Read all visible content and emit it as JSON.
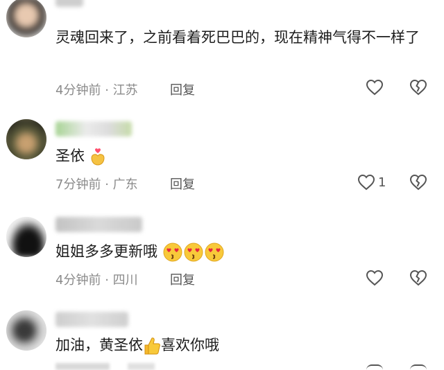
{
  "comments": [
    {
      "text": "灵魂回来了，之前看着死巴巴的，现在精神气得不一样了",
      "time": "4分钟前",
      "location": "江苏",
      "reply_label": "回复",
      "like_count": ""
    },
    {
      "text": "圣依",
      "time": "7分钟前",
      "location": "广东",
      "reply_label": "回复",
      "like_count": "1",
      "emoji_after": "heart-hands-emoji"
    },
    {
      "text": "姐姐多多更新哦",
      "time": "4分钟前",
      "location": "四川",
      "reply_label": "回复",
      "like_count": "",
      "emoji_after": "heart-eyes-kiss-emoji"
    },
    {
      "text_a": "加油，黄圣依",
      "text_b": "喜欢你哦",
      "emoji_mid": "thumbs-up-emoji"
    }
  ],
  "separator": "·",
  "colors": {
    "text": "#1c1c1c",
    "meta": "#8a8a8a",
    "icon": "#555555"
  }
}
